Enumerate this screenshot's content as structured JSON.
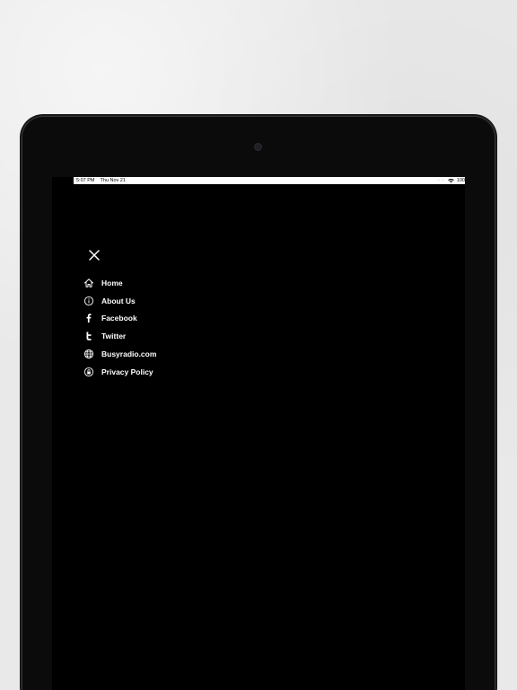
{
  "status_bar": {
    "time": "5:07 PM",
    "date": "Thu Nov 21",
    "battery": "100%"
  },
  "menu": {
    "items": [
      {
        "label": "Home",
        "icon": "home-icon"
      },
      {
        "label": "About Us",
        "icon": "info-icon"
      },
      {
        "label": "Facebook",
        "icon": "facebook-icon"
      },
      {
        "label": "Twitter",
        "icon": "twitter-icon"
      },
      {
        "label": "Busyradio.com",
        "icon": "globe-icon"
      },
      {
        "label": "Privacy Policy",
        "icon": "privacy-icon"
      }
    ]
  },
  "colors": {
    "screen_bg": "#000000",
    "text": "#ffffff",
    "device_frame": "#0b0b0b",
    "wall": "#e9e9e9"
  }
}
